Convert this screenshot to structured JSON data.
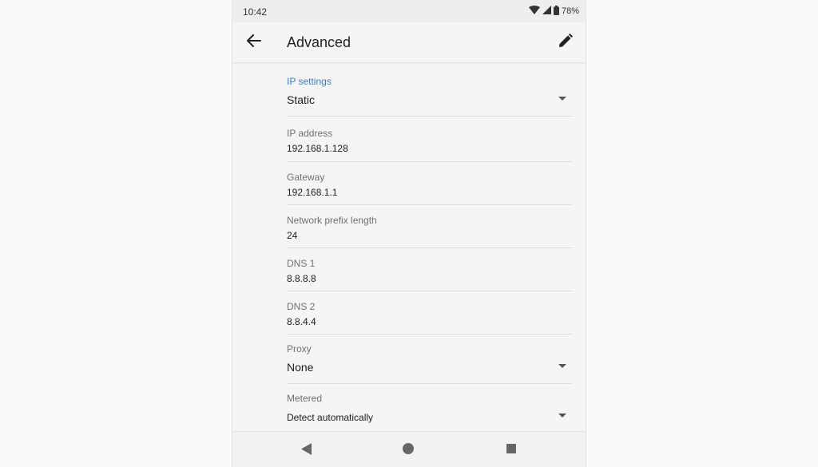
{
  "status_bar": {
    "time": "10:42",
    "battery": "78%"
  },
  "app_bar": {
    "title": "Advanced"
  },
  "fields": {
    "ip_settings": {
      "label": "IP settings",
      "value": "Static"
    },
    "ip_address": {
      "label": "IP address",
      "value": "192.168.1.128"
    },
    "gateway": {
      "label": "Gateway",
      "value": "192.168.1.1"
    },
    "prefix": {
      "label": "Network prefix length",
      "value": "24"
    },
    "dns1": {
      "label": "DNS 1",
      "value": "8.8.8.8"
    },
    "dns2": {
      "label": "DNS 2",
      "value": "8.8.4.4"
    },
    "proxy": {
      "label": "Proxy",
      "value": "None"
    },
    "metered": {
      "label": "Metered",
      "value": "Detect automatically"
    }
  },
  "icons": {
    "back": "arrow-back-icon",
    "edit": "pencil-icon",
    "wifi": "wifi-icon",
    "signal": "signal-icon",
    "battery": "battery-icon"
  },
  "colors": {
    "accent": "#3d7fc2"
  }
}
